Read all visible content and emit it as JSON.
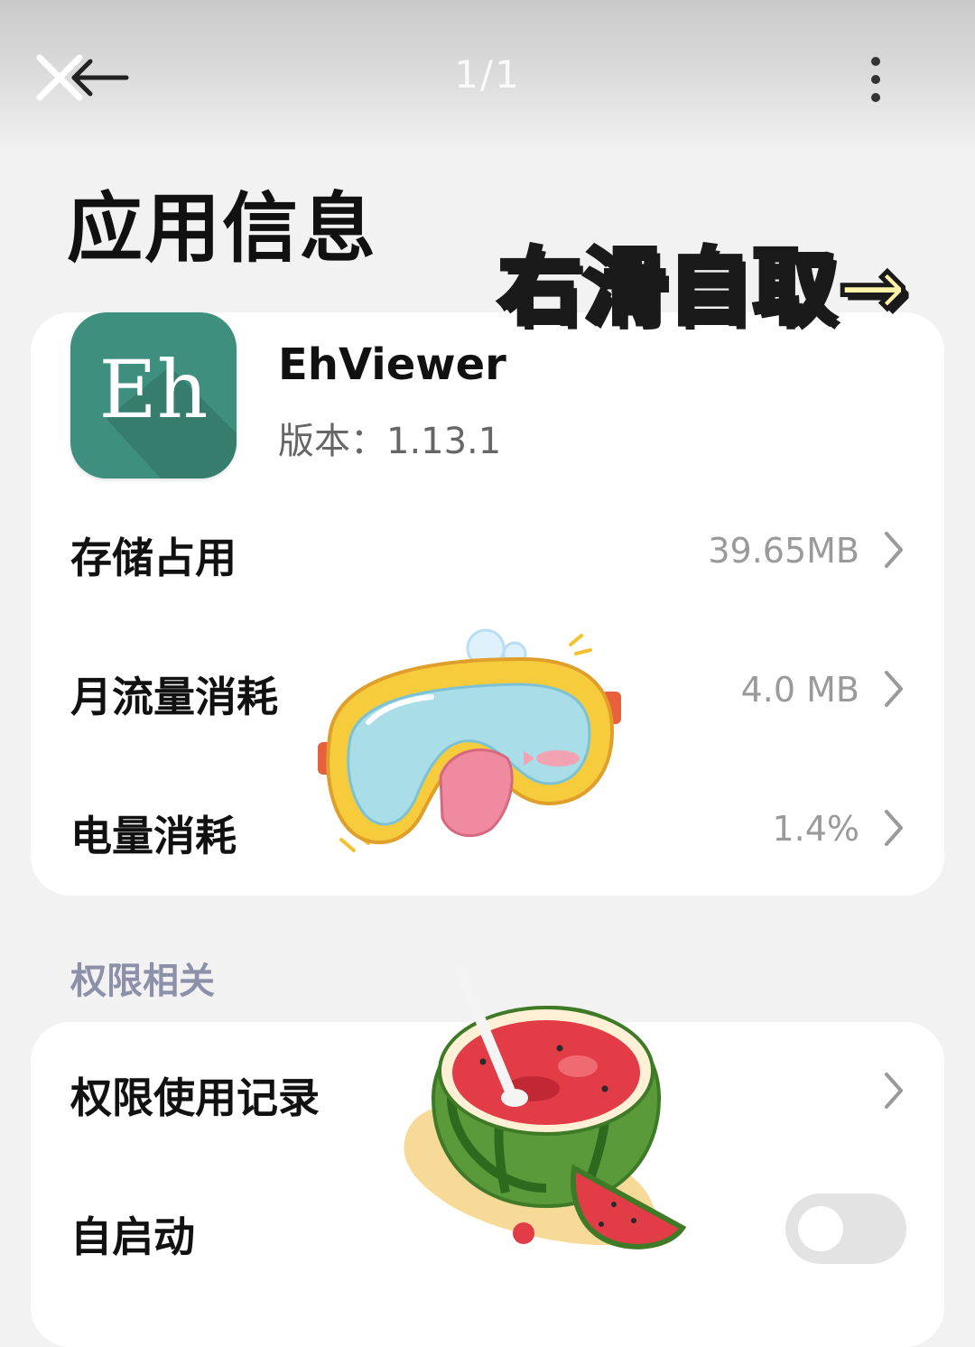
{
  "topbar": {
    "counter": "1/1",
    "icons": [
      "close-icon",
      "back-arrow-icon",
      "more-vertical-icon"
    ]
  },
  "page": {
    "title": "应用信息",
    "swipe_hint": "右滑自取→"
  },
  "app": {
    "icon_letters": "Eh",
    "icon_color": "#3f8f7e",
    "name": "EhViewer",
    "version": "版本：1.13.1"
  },
  "info_rows": [
    {
      "label": "存储占用",
      "value": "39.65MB"
    },
    {
      "label": "月流量消耗",
      "value": "4.0 MB"
    },
    {
      "label": "电量消耗",
      "value": "1.4%"
    }
  ],
  "permissions": {
    "section_title": "权限相关",
    "rows": [
      {
        "label": "权限使用记录"
      },
      {
        "label": "自启动",
        "toggle_on": false
      }
    ]
  },
  "colors": {
    "background": "#f2f2f2",
    "card": "#ffffff",
    "section_title": "#8c90a8",
    "hint_fill": "#fff4a8"
  }
}
